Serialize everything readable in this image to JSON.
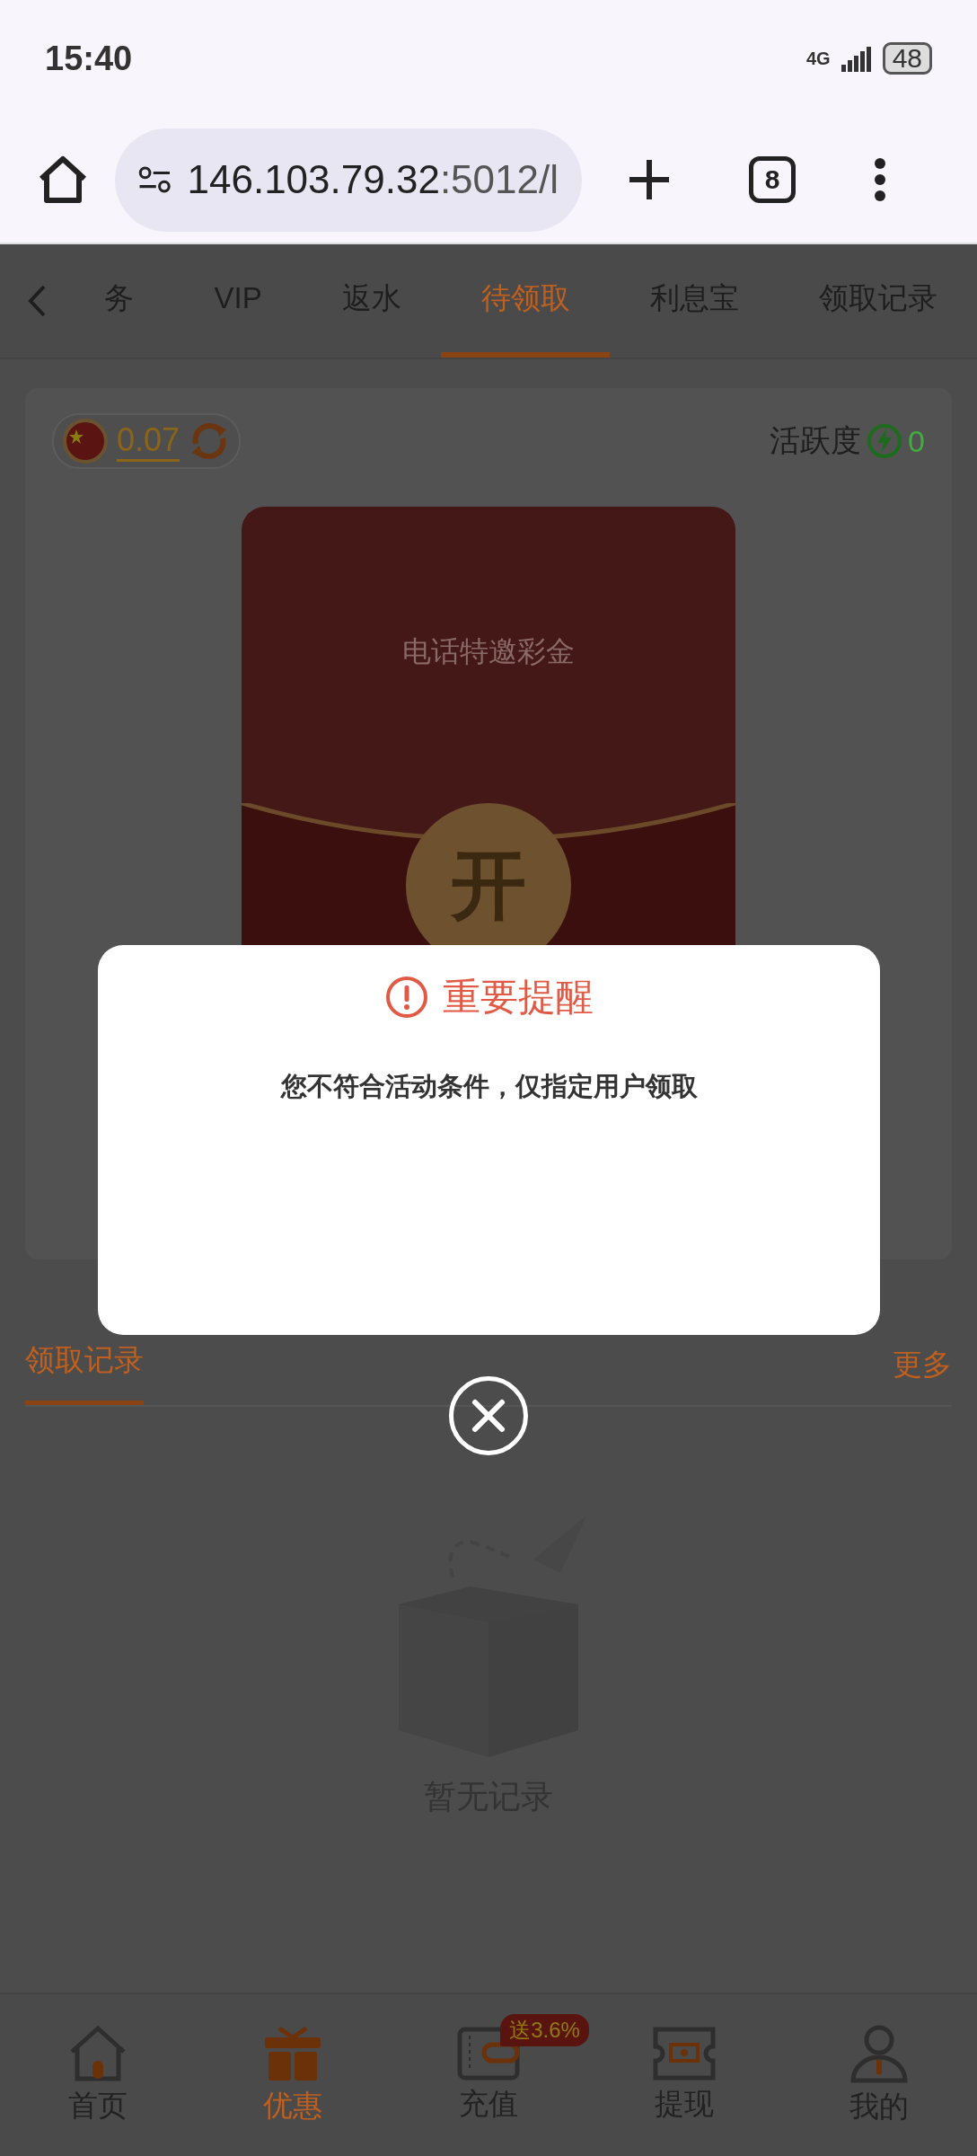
{
  "status_bar": {
    "time": "15:40",
    "network": "4G",
    "battery": "48"
  },
  "browser": {
    "url_host": "146.103.79.32",
    "url_rest": ":5012/l",
    "tab_count": "8"
  },
  "tabs": [
    {
      "label": "务",
      "selected": false
    },
    {
      "label": "VIP",
      "selected": false
    },
    {
      "label": "返水",
      "selected": false
    },
    {
      "label": "待领取",
      "selected": true
    },
    {
      "label": "利息宝",
      "selected": false
    },
    {
      "label": "领取记录",
      "selected": false
    }
  ],
  "balance": {
    "amount": "0.07"
  },
  "activity": {
    "label": "活跃度",
    "value": "0"
  },
  "envelope": {
    "title": "电话特邀彩金",
    "open_label": "开"
  },
  "records": {
    "title": "领取记录",
    "more": "更多",
    "empty_text": "暂无记录"
  },
  "dialog": {
    "title": "重要提醒",
    "message": "您不符合活动条件，仅指定用户领取"
  },
  "nav": [
    {
      "kind": "home",
      "label": "首页",
      "selected": false
    },
    {
      "kind": "gift",
      "label": "优惠",
      "selected": true
    },
    {
      "kind": "wallet",
      "label": "充值",
      "selected": false,
      "badge": "送3.6%"
    },
    {
      "kind": "ticket",
      "label": "提现",
      "selected": false
    },
    {
      "kind": "user",
      "label": "我的",
      "selected": false
    }
  ]
}
